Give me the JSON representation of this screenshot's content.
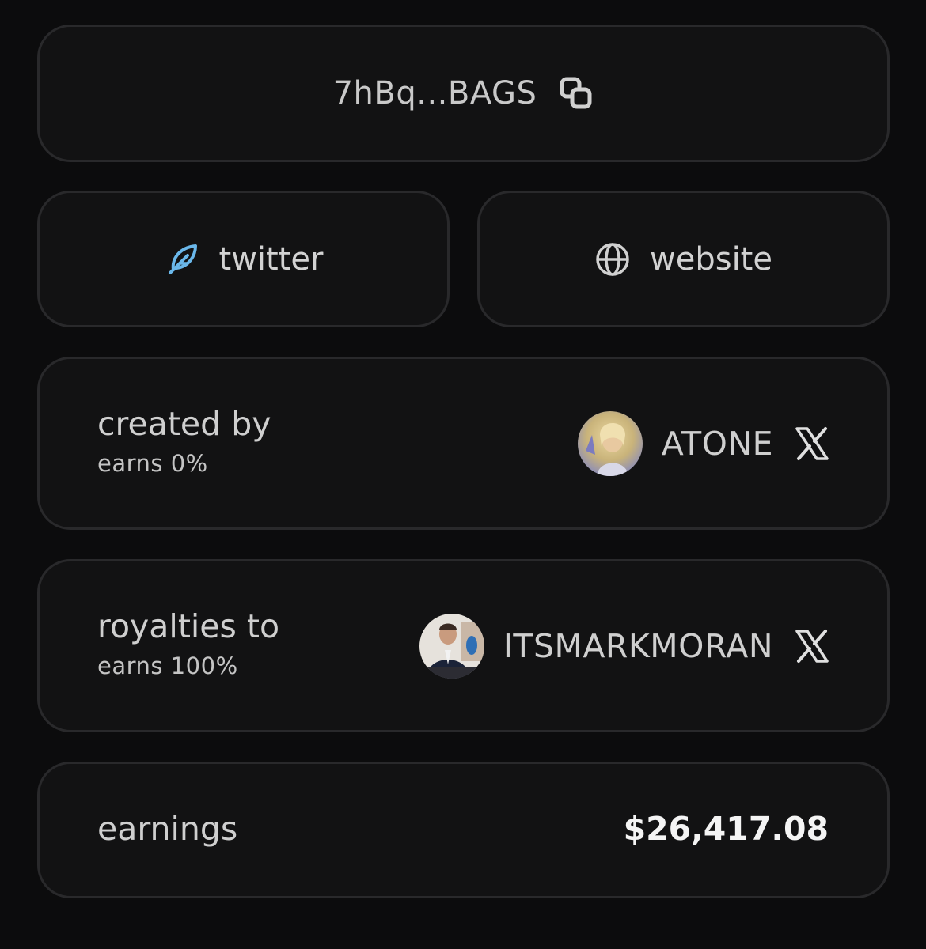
{
  "address": {
    "text": "7hBq...BAGS",
    "copy_icon": "copy-icon"
  },
  "links": {
    "twitter": {
      "label": "twitter",
      "icon": "feather-icon",
      "icon_color": "#6ab7ea"
    },
    "website": {
      "label": "website",
      "icon": "globe-icon"
    }
  },
  "creator": {
    "title": "created by",
    "earns": "earns 0%",
    "name": "ATONE",
    "social_icon": "x-icon"
  },
  "royalties": {
    "title": "royalties to",
    "earns": "earns 100%",
    "name": "ITSMARKMORAN",
    "social_icon": "x-icon"
  },
  "earnings": {
    "label": "earnings",
    "value": "$26,417.08"
  }
}
